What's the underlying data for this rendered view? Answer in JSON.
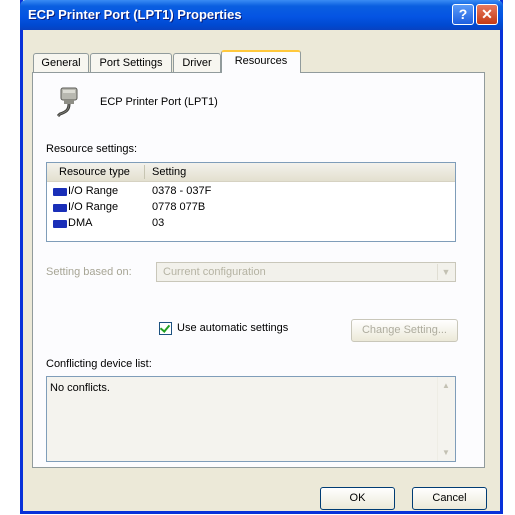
{
  "window": {
    "title": "ECP Printer Port (LPT1) Properties",
    "help_label": "?",
    "close_label": "✕"
  },
  "tabs": [
    {
      "label": "General"
    },
    {
      "label": "Port Settings"
    },
    {
      "label": "Driver"
    },
    {
      "label": "Resources",
      "active": true
    }
  ],
  "device": {
    "name": "ECP Printer Port (LPT1)",
    "icon": "printer-port-icon"
  },
  "resources": {
    "label": "Resource settings:",
    "columns": [
      "Resource type",
      "Setting"
    ],
    "rows": [
      {
        "type": "I/O Range",
        "setting": "0378 - 037F"
      },
      {
        "type": "I/O Range",
        "setting": "0778  077B"
      },
      {
        "type": "DMA",
        "setting": "03"
      }
    ]
  },
  "setting_based_on": {
    "label": "Setting based on:",
    "value": "Current configuration"
  },
  "automatic": {
    "label": "Use automatic settings",
    "checked": true
  },
  "change_setting_label": "Change Setting...",
  "conflicts": {
    "label": "Conflicting device list:",
    "text": "No conflicts."
  },
  "buttons": {
    "ok": "OK",
    "cancel": "Cancel"
  },
  "colors": {
    "title_bar": "#0554e3",
    "dialog_bg": "#ece9d8",
    "active_tab_accent": "#ffc83c",
    "resource_icon": "#1a2fb8"
  }
}
